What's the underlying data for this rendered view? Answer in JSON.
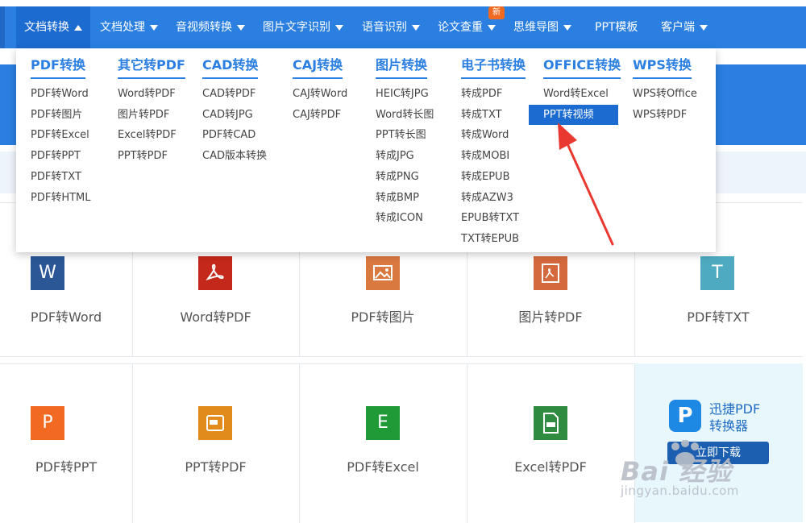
{
  "nav": {
    "first_label": "三",
    "items": [
      {
        "label": "文档转换"
      },
      {
        "label": "文档处理"
      },
      {
        "label": "音视频转换"
      },
      {
        "label": "图片文字识别"
      },
      {
        "label": "语音识别"
      },
      {
        "label": "论文查重"
      },
      {
        "label": "思维导图"
      },
      {
        "label": "PPT模板"
      },
      {
        "label": "客户端"
      }
    ],
    "new_badge": "新"
  },
  "dropdown": {
    "columns": [
      {
        "title": "PDF转换",
        "links": [
          "PDF转Word",
          "PDF转图片",
          "PDF转Excel",
          "PDF转PPT",
          "PDF转TXT",
          "PDF转HTML"
        ]
      },
      {
        "title": "其它转PDF",
        "links": [
          "Word转PDF",
          "图片转PDF",
          "Excel转PDF",
          "PPT转PDF"
        ]
      },
      {
        "title": "CAD转换",
        "links": [
          "CAD转PDF",
          "CAD转JPG",
          "PDF转CAD",
          "CAD版本转换"
        ]
      },
      {
        "title": "CAJ转换",
        "links": [
          "CAJ转Word",
          "CAJ转PDF"
        ]
      },
      {
        "title": "图片转换",
        "links": [
          "HEIC转JPG",
          "Word转长图",
          "PPT转长图",
          "转成JPG",
          "转成PNG",
          "转成BMP",
          "转成ICON"
        ]
      },
      {
        "title": "电子书转换",
        "links": [
          "转成PDF",
          "转成TXT",
          "转成Word",
          "转成MOBI",
          "转成EPUB",
          "转成AZW3",
          "EPUB转TXT",
          "TXT转EPUB"
        ]
      },
      {
        "title": "OFFICE转换",
        "links": [
          "Word转Excel",
          "PPT转视频"
        ]
      },
      {
        "title": "WPS转换",
        "links": [
          "WPS转Office",
          "WPS转PDF"
        ]
      }
    ],
    "selected": "PPT转视频"
  },
  "tiles": {
    "row1": [
      {
        "label": "PDF转Word",
        "glyph": "W",
        "icon": "word-icon",
        "color": "#2b5797"
      },
      {
        "label": "Word转PDF",
        "glyph": "",
        "icon": "pdf-icon",
        "color": "#c4281b"
      },
      {
        "label": "PDF转图片",
        "glyph": "",
        "icon": "image-icon",
        "color": "#d9783f"
      },
      {
        "label": "图片转PDF",
        "glyph": "",
        "icon": "pdf-icon",
        "color": "#d4693d"
      },
      {
        "label": "PDF转TXT",
        "glyph": "T",
        "icon": "txt-icon",
        "color": "#4eaac0"
      }
    ],
    "row2": [
      {
        "label": "PDF转PPT",
        "glyph": "P",
        "icon": "ppt-icon",
        "color": "#f26a22"
      },
      {
        "label": "PPT转PDF",
        "glyph": "",
        "icon": "pdf-file-icon",
        "color": "#e08b1c"
      },
      {
        "label": "PDF转Excel",
        "glyph": "E",
        "icon": "excel-icon",
        "color": "#1f9a36"
      },
      {
        "label": "Excel转PDF",
        "glyph": "",
        "icon": "pdf-file-icon",
        "color": "#2e8b40"
      }
    ]
  },
  "promo": {
    "logo": "P",
    "name_line1": "迅捷PDF",
    "name_line2": "转换器",
    "download": "立即下载"
  },
  "watermark": {
    "logo_text": "Bai  经验",
    "url": "jingyan.baidu.com"
  },
  "colors": {
    "primary": "#2a7fe1",
    "selected": "#1c6bd1",
    "arrow": "#e8382f",
    "badge": "#f06a21"
  }
}
